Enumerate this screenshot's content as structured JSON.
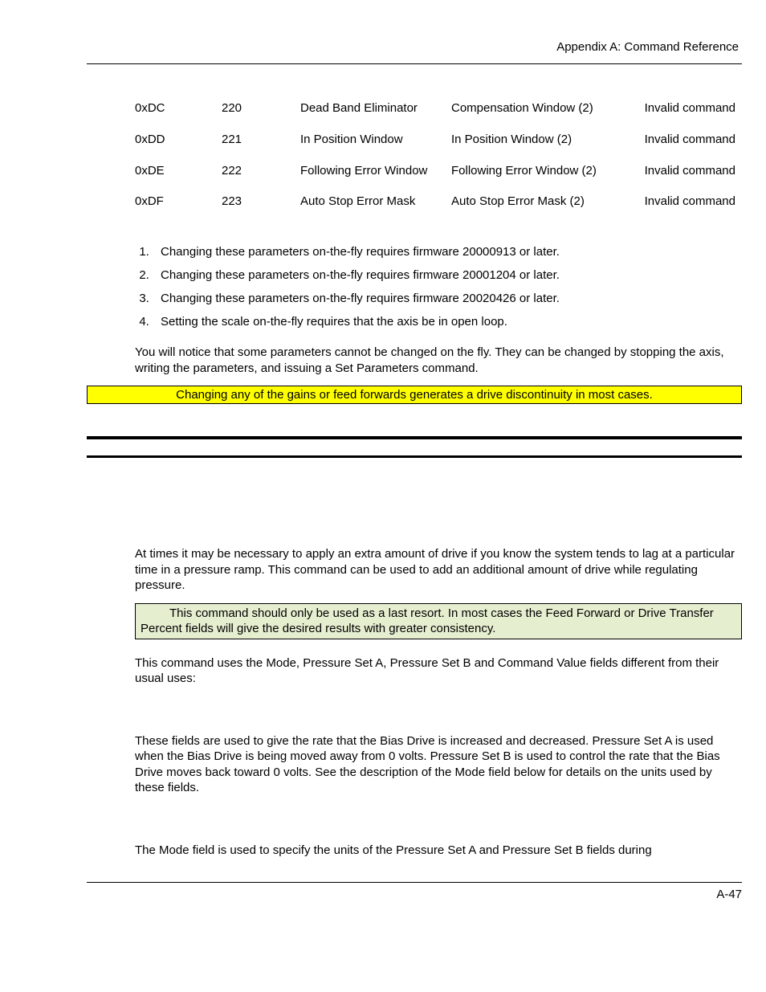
{
  "header": {
    "breadcrumb": "Appendix A:  Command Reference"
  },
  "table": {
    "rows": [
      {
        "hex": "0xDC",
        "dec": "220",
        "name1": "Dead Band Eliminator",
        "name2": "Compensation Window (2)",
        "status": "Invalid command"
      },
      {
        "hex": "0xDD",
        "dec": "221",
        "name1": "In Position Window",
        "name2": "In Position Window (2)",
        "status": "Invalid command"
      },
      {
        "hex": "0xDE",
        "dec": "222",
        "name1": "Following Error Window",
        "name2": "Following Error Window (2)",
        "status": "Invalid command"
      },
      {
        "hex": "0xDF",
        "dec": "223",
        "name1": "Auto Stop Error Mask",
        "name2": "Auto Stop Error Mask (2)",
        "status": "Invalid command"
      }
    ]
  },
  "notes": [
    "Changing these parameters on-the-fly requires firmware 20000913 or later.",
    "Changing these parameters on-the-fly requires firmware 20001204 or later.",
    "Changing these parameters on-the-fly requires firmware 20020426 or later.",
    "Setting the scale on-the-fly requires that the axis be in open loop."
  ],
  "para1": "You will notice that some parameters cannot be changed on the fly. They can be changed by stopping the axis, writing the parameters, and issuing a Set Parameters command.",
  "yellow": "Changing any of the gains or feed forwards generates a drive discontinuity in most cases.",
  "sec2": {
    "p1": "At times it may be necessary to apply an extra amount of drive if you know the system tends to lag at a particular time in a pressure ramp. This command can be used to add an additional amount of drive while regulating pressure.",
    "green": "This command should only be used as a last resort. In most cases the Feed Forward or Drive Transfer Percent fields will give the desired results with greater consistency.",
    "p2": "This command uses the Mode, Pressure Set A, Pressure Set B and Command Value fields different from their usual uses:",
    "p3": "These fields are used to give the rate that the Bias Drive is increased and decreased. Pressure Set A is used when the Bias Drive is being moved away from 0 volts. Pressure Set B is used to control the rate that the Bias Drive moves back toward 0 volts. See the description of the Mode field below for details on the units used by these fields.",
    "p4": "The Mode field is used to specify the units of the Pressure Set A and Pressure Set B fields during"
  },
  "footer": {
    "page": "A-47"
  }
}
